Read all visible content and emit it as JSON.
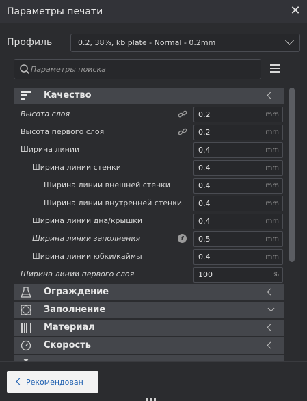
{
  "window": {
    "title": "Параметры печати"
  },
  "profile": {
    "label": "Профиль",
    "value": "0.2, 38%, kb plate - Normal - 0.2mm"
  },
  "search": {
    "placeholder": "Параметры поиска"
  },
  "categories": {
    "quality": "Качество",
    "shell": "Ограждение",
    "infill": "Заполнение",
    "material": "Материал",
    "speed": "Скорость"
  },
  "settings": [
    {
      "label": "Высота слоя",
      "value": "0.2",
      "unit": "mm"
    },
    {
      "label": "Высота первого слоя",
      "value": "0.2",
      "unit": "mm"
    },
    {
      "label": "Ширина линии",
      "value": "0.4",
      "unit": "mm"
    },
    {
      "label": "Ширина линии стенки",
      "value": "0.4",
      "unit": "mm"
    },
    {
      "label": "Ширина линии внешней стенки",
      "value": "0.4",
      "unit": "mm"
    },
    {
      "label": "Ширина линии внутренней стенки",
      "value": "0.4",
      "unit": "mm"
    },
    {
      "label": "Ширина линии дна/крышки",
      "value": "0.4",
      "unit": "mm"
    },
    {
      "label": "Ширина линии заполнения",
      "value": "0.5",
      "unit": "mm"
    },
    {
      "label": "Ширина линии юбки/каймы",
      "value": "0.4",
      "unit": "mm"
    },
    {
      "label": "Ширина линии первого слоя",
      "value": "100",
      "unit": "%"
    }
  ],
  "footer": {
    "recommended_label": "Рекомендован"
  },
  "icons": {
    "close": "close-icon",
    "search": "search-icon",
    "menu": "menu-icon",
    "link": "link-icon",
    "function": "function-icon"
  },
  "colors": {
    "background": "#2b2c2f",
    "category_header": "#44464b",
    "button_text": "#1d5fb0"
  }
}
